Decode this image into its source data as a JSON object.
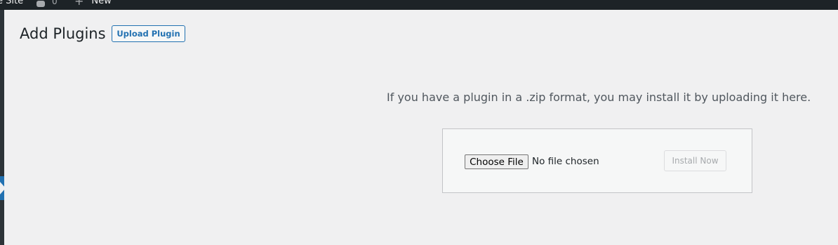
{
  "admin_bar": {
    "site_name": "e Site",
    "comments_count": "0",
    "new_label": "New"
  },
  "page": {
    "title": "Add Plugins",
    "upload_button": "Upload Plugin"
  },
  "upload": {
    "help_text": "If you have a plugin in a .zip format, you may install it by uploading it here.",
    "choose_file_label": "Choose File",
    "file_status": "No file chosen",
    "install_button": "Install Now"
  },
  "colors": {
    "admin_bar_bg": "#1d2327",
    "accent": "#2271b1",
    "page_bg": "#f0f0f1"
  },
  "icons": {
    "comments": "comment-bubble-icon",
    "new": "plus-icon"
  }
}
